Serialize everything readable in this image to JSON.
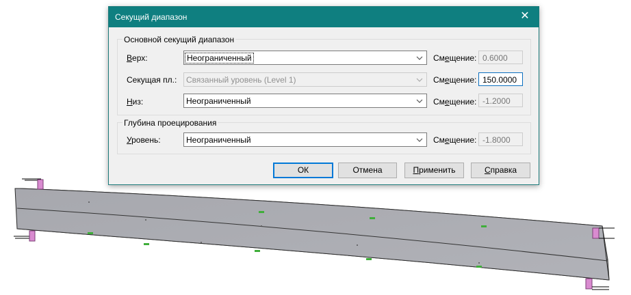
{
  "dialog": {
    "title": "Секущий диапазон",
    "close_glyph": "✕",
    "primary_group": {
      "title": "Основной секущий диапазон",
      "rows": [
        {
          "label_key": "В",
          "label_rest": "ерх:",
          "combo_value": "Неограниченный",
          "offset_label_a": "См",
          "offset_label_key": "е",
          "offset_label_b": "щение:",
          "offset_value": "0.6000",
          "combo_state": "focused",
          "offset_state": "disabled"
        },
        {
          "label_key": "",
          "label_rest": "Секущая пл.:",
          "combo_value": "Связанный уровень (Level 1)",
          "offset_label_a": "См",
          "offset_label_key": "е",
          "offset_label_b": "щение:",
          "offset_value": "150.0000",
          "combo_state": "disabled",
          "offset_state": "active"
        },
        {
          "label_key": "Н",
          "label_rest": "из:",
          "combo_value": "Неограниченный",
          "offset_label_a": "См",
          "offset_label_key": "е",
          "offset_label_b": "щение:",
          "offset_value": "-1.2000",
          "combo_state": "normal",
          "offset_state": "disabled"
        }
      ]
    },
    "depth_group": {
      "title": "Глубина проецирования",
      "row": {
        "label_key": "У",
        "label_rest": "ровень:",
        "combo_value": "Неограниченный",
        "offset_label_a": "См",
        "offset_label_key": "е",
        "offset_label_b": "щение:",
        "offset_value": "-1.8000"
      }
    },
    "buttons": {
      "ok": "ОК",
      "cancel": "Отмена",
      "apply_key": "П",
      "apply_rest": "рименить",
      "help_key": "С",
      "help_rest": "правка"
    }
  },
  "colors": {
    "titlebar": "#0f7f80",
    "beam_face": "#a9aab0",
    "beam_face_dark": "#9c9da4",
    "bracket": "#d98bd0",
    "markers": "#3fae3a"
  }
}
